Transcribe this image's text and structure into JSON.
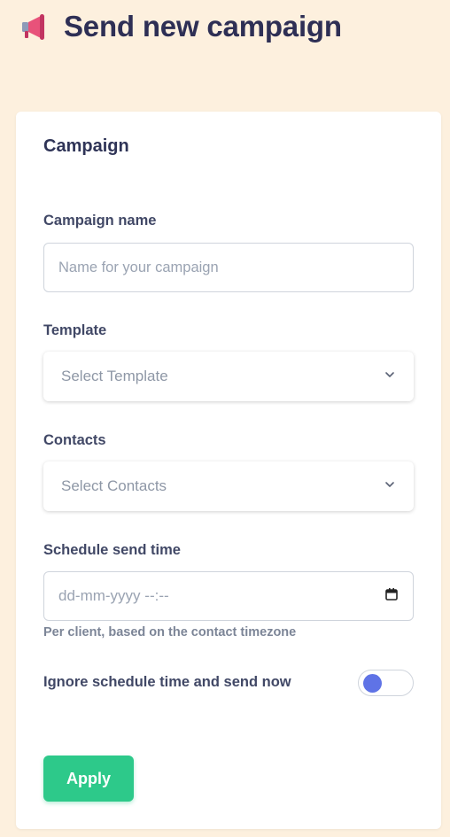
{
  "header": {
    "icon": "megaphone-icon",
    "title": "Send new campaign"
  },
  "form": {
    "section_title": "Campaign",
    "campaign_name": {
      "label": "Campaign name",
      "placeholder": "Name for your campaign",
      "value": ""
    },
    "template": {
      "label": "Template",
      "selected": "Select Template"
    },
    "contacts": {
      "label": "Contacts",
      "selected": "Select Contacts"
    },
    "schedule": {
      "label": "Schedule send time",
      "placeholder": "dd-mm-yyyy --:--",
      "help": "Per client, based on the contact timezone"
    },
    "send_now": {
      "label": "Ignore schedule time and send now",
      "enabled": false
    },
    "apply_label": "Apply"
  },
  "colors": {
    "page_background": "#fdf0de",
    "title": "#2e2f55",
    "accent_button": "#2dc98a",
    "toggle_knob": "#5f73e6"
  }
}
